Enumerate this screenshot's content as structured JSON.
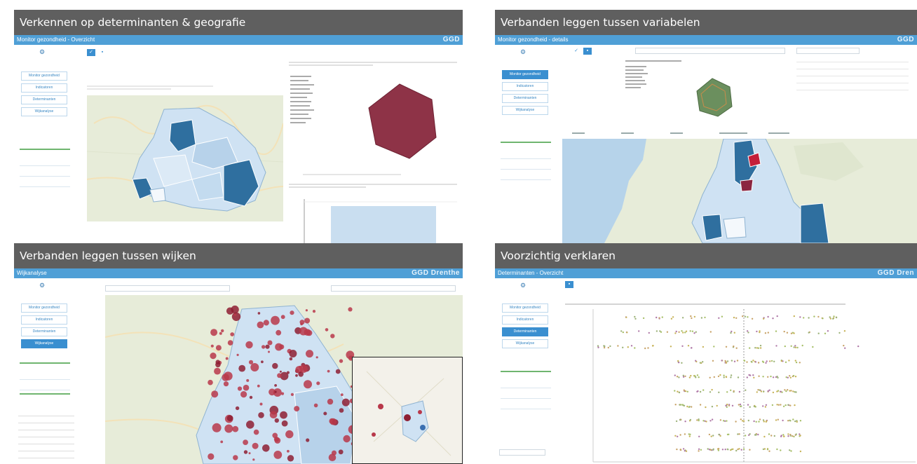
{
  "panels": {
    "p1": {
      "caption": "Verkennen op determinanten & geografie",
      "app_title": "Monitor gezondheid - Overzicht",
      "logo": "GGD"
    },
    "p2": {
      "caption": "Verbanden leggen tussen variabelen",
      "app_title": "Monitor gezondheid - details",
      "logo": "GGD"
    },
    "p3": {
      "caption": "Verbanden leggen tussen wijken",
      "app_title": "Wijkanalyse",
      "logo": "GGD Drenthe"
    },
    "p4": {
      "caption": "Voorzichtig verklaren",
      "app_title": "Determinanten - Overzicht",
      "logo": "GGD Dren"
    }
  },
  "nav": {
    "p1": [
      "Monitor gezondheid",
      "Indicatoren",
      "Determinanten",
      "Wijkanalyse"
    ],
    "p2": [
      "Monitor gezondheid",
      "Indicatoren",
      "Determinanten",
      "Wijkanalyse"
    ],
    "p3": [
      "Monitor gezondheid",
      "Indicatoren",
      "Determinanten",
      "Wijkanalyse"
    ],
    "p4": [
      "Monitor gezondheid",
      "Indicatoren",
      "Determinanten",
      "Wijkanalyse"
    ]
  },
  "active_nav": {
    "p1": 0,
    "p2": 0,
    "p3": 3,
    "p4": 2
  },
  "colors": {
    "caption_bg": "#5f5f5f",
    "appbar": "#4f9fd6",
    "map_land": "#e7ecd9",
    "map_water": "#b6d3ea",
    "region_light": "#cfe2f3",
    "region_dark": "#2f6f9f",
    "radar_fill": "#8e3347",
    "radar_green": "#6b8f5e",
    "dot_red": "#b8384a",
    "bar_fill": "#c9def0"
  },
  "icons": [
    "gear-icon",
    "map-tab-icon",
    "chart-tab-icon",
    "dropdown-chevron-icon"
  ]
}
